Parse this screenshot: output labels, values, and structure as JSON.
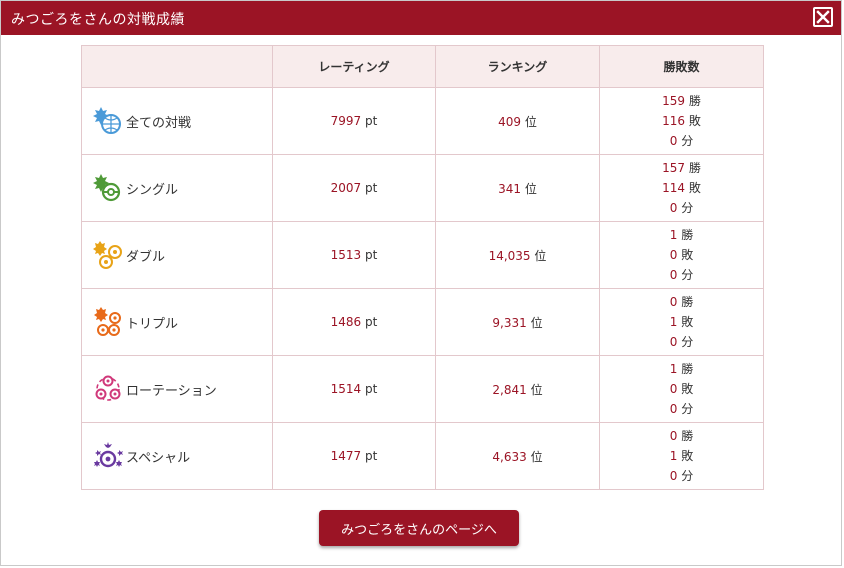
{
  "dialog": {
    "title": "みつごろをさんの対戦成績",
    "close_label": "閉じる"
  },
  "table": {
    "headers": [
      "",
      "レーティング",
      "ランキング",
      "勝敗数"
    ],
    "rows": [
      {
        "name": "全ての対戦",
        "icon": "all-battles-icon",
        "rating": "7997",
        "rating_unit": "pt",
        "rank": "409",
        "rank_unit": "位",
        "wins": "159",
        "losses": "116",
        "draws": "0"
      },
      {
        "name": "シングル",
        "icon": "single-battle-icon",
        "rating": "2007",
        "rating_unit": "pt",
        "rank": "341",
        "rank_unit": "位",
        "wins": "157",
        "losses": "114",
        "draws": "0"
      },
      {
        "name": "ダブル",
        "icon": "double-battle-icon",
        "rating": "1513",
        "rating_unit": "pt",
        "rank": "14,035",
        "rank_unit": "位",
        "wins": "1",
        "losses": "0",
        "draws": "0"
      },
      {
        "name": "トリプル",
        "icon": "triple-battle-icon",
        "rating": "1486",
        "rating_unit": "pt",
        "rank": "9,331",
        "rank_unit": "位",
        "wins": "0",
        "losses": "1",
        "draws": "0"
      },
      {
        "name": "ローテーション",
        "icon": "rotation-battle-icon",
        "rating": "1514",
        "rating_unit": "pt",
        "rank": "2,841",
        "rank_unit": "位",
        "wins": "1",
        "losses": "0",
        "draws": "0"
      },
      {
        "name": "スペシャル",
        "icon": "special-battle-icon",
        "rating": "1477",
        "rating_unit": "pt",
        "rank": "4,633",
        "rank_unit": "位",
        "wins": "0",
        "losses": "1",
        "draws": "0"
      }
    ],
    "win_label": "勝",
    "loss_label": "敗",
    "draw_label": "分"
  },
  "footer": {
    "button_label": "みつごろをさんのページへ"
  },
  "colors": {
    "brand": "#9b1425",
    "header_bg": "#f8ecec",
    "border": "#e3c8cc",
    "all_icon": "#4a9ad8",
    "single_icon": "#4f9a38",
    "double_icon": "#e8a317",
    "triple_icon": "#e86a1a",
    "rotation_icon": "#d0387a",
    "special_icon": "#6a3aa0"
  }
}
